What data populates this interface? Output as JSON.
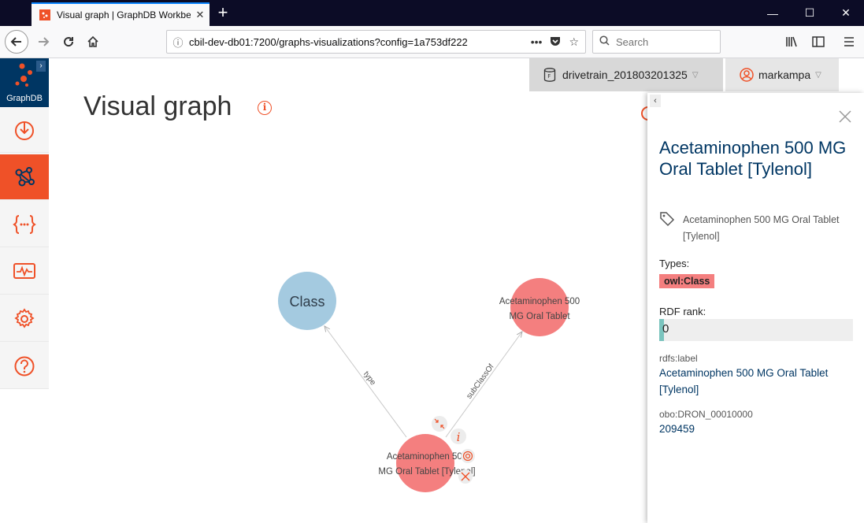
{
  "browser": {
    "tab_title": "Visual graph | GraphDB Workbe",
    "url": "cbil-dev-db01:7200/graphs-visualizations?config=1a753df222",
    "search_placeholder": "Search"
  },
  "app": {
    "logo_text": "GraphDB",
    "repository": "drivetrain_201803201325",
    "user": "markampa",
    "page_title": "Visual graph",
    "sidebar": [
      {
        "icon": "import-icon"
      },
      {
        "icon": "graph-icon",
        "active": true
      },
      {
        "icon": "sparql-icon"
      },
      {
        "icon": "monitor-icon"
      },
      {
        "icon": "settings-icon"
      },
      {
        "icon": "help-icon"
      }
    ]
  },
  "graph": {
    "nodes": [
      {
        "label": "Class",
        "color": "#a4cae0"
      },
      {
        "label_line1": "Acetaminophen 500",
        "label_line2": "MG Oral Tablet",
        "color": "#f47f7f"
      },
      {
        "label_line1": "Acetaminophen 500",
        "label_line2": "MG Oral Tablet [Tylenol]",
        "color": "#f47f7f"
      }
    ],
    "edges": [
      {
        "label": "type"
      },
      {
        "label": "subClassOf"
      }
    ]
  },
  "panel": {
    "title": "Acetaminophen 500 MG Oral Tablet [Tylenol]",
    "label": "Acetaminophen 500 MG Oral Tablet [Tylenol]",
    "types_heading": "Types:",
    "type": "owl:Class",
    "rank_heading": "RDF rank:",
    "rank_value": "0",
    "props": [
      {
        "key": "rdfs:label",
        "value": "Acetaminophen 500 MG Oral Tablet [Tylenol]"
      },
      {
        "key": "obo:DRON_00010000",
        "value": "209459"
      }
    ]
  },
  "colors": {
    "accent": "#ef5128",
    "navy": "#003663"
  }
}
